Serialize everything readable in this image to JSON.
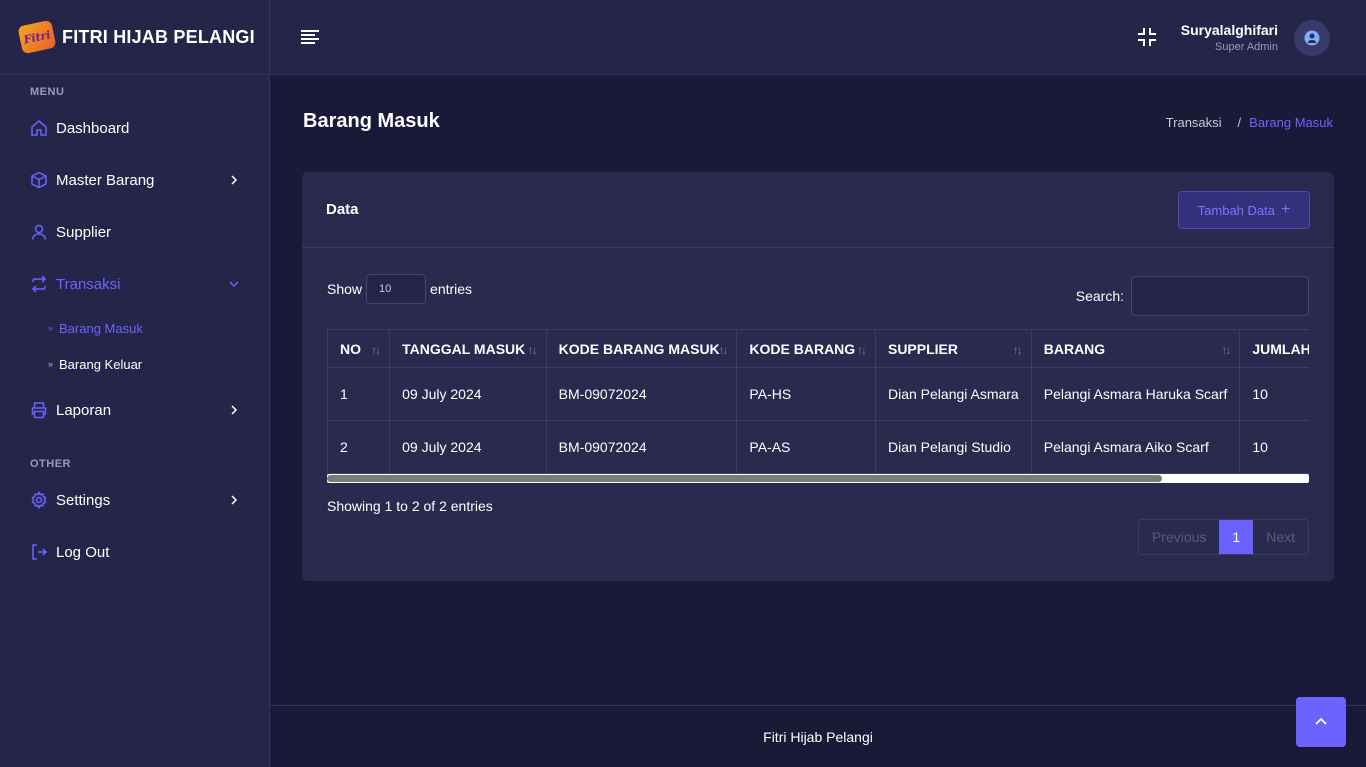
{
  "brand": {
    "name": "FITRI HIJAB PELANGI",
    "logo_text": "Fitri"
  },
  "colors": {
    "accent": "#6c63ff",
    "sidebar_bg": "#25254a",
    "page_bg": "#1a1a38",
    "card_bg": "#2a2a4e"
  },
  "sidebar": {
    "section_menu": "MENU",
    "section_other": "OTHER",
    "items": [
      {
        "label": "Dashboard",
        "icon": "home-icon"
      },
      {
        "label": "Master Barang",
        "icon": "box-icon"
      },
      {
        "label": "Supplier",
        "icon": "user-icon"
      },
      {
        "label": "Transaksi",
        "icon": "transfer-icon"
      },
      {
        "label": "Laporan",
        "icon": "printer-icon"
      },
      {
        "label": "Settings",
        "icon": "gear-icon"
      },
      {
        "label": "Log Out",
        "icon": "logout-icon"
      }
    ],
    "sub_items": [
      {
        "label": "Barang Masuk"
      },
      {
        "label": "Barang Keluar"
      }
    ]
  },
  "header": {
    "user_name": "Suryalalghifari",
    "user_role": "Super Admin"
  },
  "page": {
    "title": "Barang Masuk",
    "breadcrumb": {
      "parent": "Transaksi",
      "separator": "/",
      "current": "Barang Masuk"
    }
  },
  "card": {
    "title": "Data",
    "add_button": "Tambah Data",
    "add_button_icon": "+",
    "show_label": "Show",
    "entries_label": "entries",
    "page_length": "10",
    "search_label": "Search:",
    "search_value": "",
    "info": "Showing 1 to 2 of 2 entries",
    "scroll_position": 0.85
  },
  "table": {
    "sort_icon": "↑↓",
    "headers": [
      "NO",
      "TANGGAL MASUK",
      "KODE BARANG MASUK",
      "KODE BARANG",
      "SUPPLIER",
      "BARANG",
      "JUMLAH"
    ],
    "rows": [
      [
        "1",
        "09 July 2024",
        "BM-09072024",
        "PA-HS",
        "Dian Pelangi Asmara",
        "Pelangi Asmara Haruka Scarf",
        "10"
      ],
      [
        "2",
        "09 July 2024",
        "BM-09072024",
        "PA-AS",
        "Dian Pelangi Studio",
        "Pelangi Asmara Aiko Scarf",
        "10"
      ]
    ]
  },
  "pagination": {
    "previous": "Previous",
    "current": "1",
    "next": "Next"
  },
  "footer": {
    "text": "Fitri Hijab Pelangi"
  }
}
